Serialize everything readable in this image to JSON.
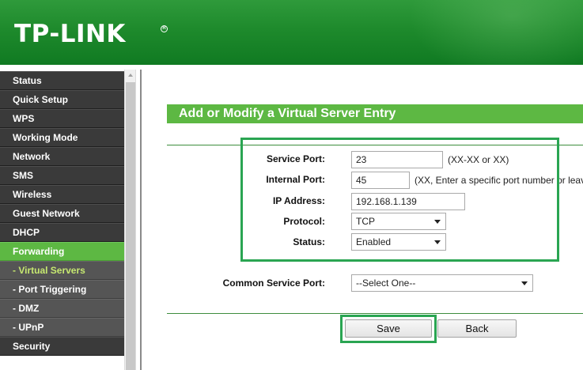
{
  "brand": {
    "logo_text": "TP-LINK",
    "registered_mark": "R"
  },
  "colors": {
    "brand_green": "#1e8a2c",
    "accent_green": "#5db843",
    "highlight_box": "#2aa552",
    "menu_dark": "#3a3a3a",
    "submenu": "#555555",
    "submenu_selected_text": "#c6e870"
  },
  "sidebar": {
    "items": [
      {
        "label": "Status"
      },
      {
        "label": "Quick Setup"
      },
      {
        "label": "WPS"
      },
      {
        "label": "Working Mode"
      },
      {
        "label": "Network"
      },
      {
        "label": "SMS"
      },
      {
        "label": "Wireless"
      },
      {
        "label": "Guest Network"
      },
      {
        "label": "DHCP"
      },
      {
        "label": "Forwarding",
        "active": true
      },
      {
        "label": "- Virtual Servers",
        "sub": true,
        "selected": true
      },
      {
        "label": "- Port Triggering",
        "sub": true
      },
      {
        "label": "- DMZ",
        "sub": true
      },
      {
        "label": "- UPnP",
        "sub": true
      },
      {
        "label": "Security"
      }
    ]
  },
  "form": {
    "title": "Add or Modify a Virtual Server Entry",
    "service_port": {
      "label": "Service Port:",
      "value": "23",
      "hint": "(XX-XX or XX)"
    },
    "internal_port": {
      "label": "Internal Port:",
      "value": "45",
      "hint": "(XX, Enter a specific port number or leav"
    },
    "ip_address": {
      "label": "IP Address:",
      "value": "192.168.1.139"
    },
    "protocol": {
      "label": "Protocol:",
      "value": "TCP"
    },
    "status": {
      "label": "Status:",
      "value": "Enabled"
    },
    "common_service_port": {
      "label": "Common Service Port:",
      "value": "--Select One--"
    }
  },
  "buttons": {
    "save": "Save",
    "back": "Back"
  },
  "icons": {
    "dropdown": "chevron-down-icon",
    "scroll_up": "triangle-up-icon"
  }
}
